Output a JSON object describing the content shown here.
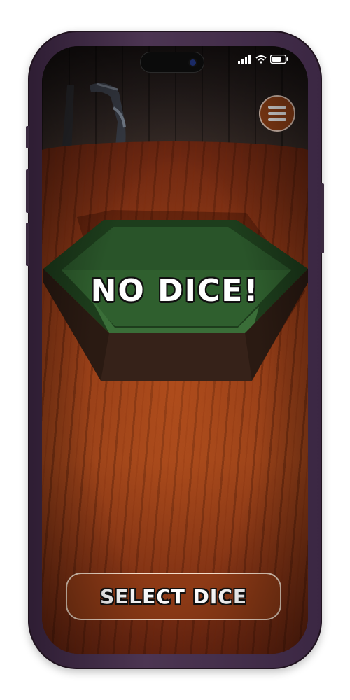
{
  "game": {
    "status_text": "NO DICE!",
    "select_button_label": "SELECT DICE"
  },
  "status_bar": {
    "icons": [
      "signal-icon",
      "wifi-icon",
      "battery-icon"
    ]
  },
  "menu": {
    "icon": "hamburger-menu-icon"
  },
  "colors": {
    "accent": "#9a4518",
    "table_wood": "#8e3916",
    "felt": "#2d5a2c",
    "phone_frame": "#4c3552"
  }
}
